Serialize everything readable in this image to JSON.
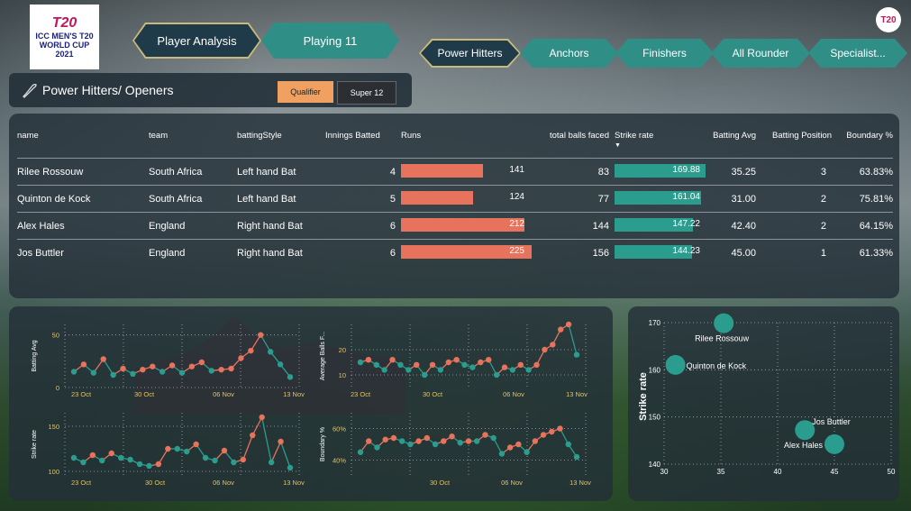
{
  "logo": {
    "brand": "T20",
    "line1": "ICC MEN'S T20",
    "line2": "WORLD CUP",
    "year": "2021",
    "small": "T20"
  },
  "nav_main": [
    {
      "label": "Player Analysis"
    },
    {
      "label": "Playing 11"
    }
  ],
  "nav_tabs": [
    {
      "label": "Power Hitters"
    },
    {
      "label": "Anchors"
    },
    {
      "label": "Finishers"
    },
    {
      "label": "All Rounder"
    },
    {
      "label": "Specialist..."
    }
  ],
  "section": {
    "title": "Power Hitters/ Openers",
    "filters": [
      {
        "label": "Qualifier"
      },
      {
        "label": "Super 12"
      }
    ]
  },
  "table": {
    "columns": {
      "name": "name",
      "team": "team",
      "style": "battingStyle",
      "innings": "Innings Batted",
      "runs": "Runs",
      "balls": "total balls faced",
      "sr": "Strike rate",
      "avg": "Batting Avg",
      "pos": "Batting Position",
      "bnd": "Boundary %"
    },
    "rows": [
      {
        "name": "Rilee Rossouw",
        "team": "South Africa",
        "style": "Left hand Bat",
        "innings": "4",
        "runs": "141",
        "runs_v": 141,
        "balls": "83",
        "sr": "169.88",
        "sr_v": 169.88,
        "avg": "35.25",
        "pos": "3",
        "bnd": "63.83%"
      },
      {
        "name": "Quinton de Kock",
        "team": "South Africa",
        "style": "Left hand Bat",
        "innings": "5",
        "runs": "124",
        "runs_v": 124,
        "balls": "77",
        "sr": "161.04",
        "sr_v": 161.04,
        "avg": "31.00",
        "pos": "2",
        "bnd": "75.81%"
      },
      {
        "name": "Alex Hales",
        "team": "England",
        "style": "Right hand Bat",
        "innings": "6",
        "runs": "212",
        "runs_v": 212,
        "balls": "144",
        "sr": "147.22",
        "sr_v": 147.22,
        "avg": "42.40",
        "pos": "2",
        "bnd": "64.15%"
      },
      {
        "name": "Jos Buttler",
        "team": "England",
        "style": "Right hand Bat",
        "innings": "6",
        "runs": "225",
        "runs_v": 225,
        "balls": "156",
        "sr": "144.23",
        "sr_v": 144.23,
        "avg": "45.00",
        "pos": "1",
        "bnd": "61.33%"
      }
    ]
  },
  "colors": {
    "runs_bar": "#e8735c",
    "sr_bar": "#2a9d8f",
    "teal_line": "#2a9d8f",
    "orange_line": "#e8735c",
    "axis_text": "#e0c36a"
  },
  "chart_data": [
    {
      "type": "line",
      "ylabel": "Batting Avg",
      "yticks": [
        "50",
        "0"
      ],
      "ylim": [
        0,
        60
      ],
      "xticks": [
        "23 Oct",
        "30 Oct",
        "06 Nov",
        "13 Nov"
      ],
      "series": [
        {
          "values": [
            15,
            22,
            14,
            27,
            12,
            18,
            13,
            17,
            20,
            15,
            21,
            14,
            20,
            24,
            16,
            17,
            18,
            28,
            35,
            50,
            34,
            22,
            10
          ]
        }
      ]
    },
    {
      "type": "line",
      "ylabel": "Average Balls F...",
      "yticks": [
        "20",
        "10"
      ],
      "ylim": [
        5,
        30
      ],
      "xticks": [
        "23 Oct",
        "30 Oct",
        "06 Nov",
        "13 Nov"
      ],
      "series": [
        {
          "values": [
            15,
            16,
            14,
            12,
            16,
            14,
            12,
            14,
            10,
            14,
            12,
            15,
            16,
            14,
            13,
            15,
            16,
            10,
            13,
            12,
            14,
            12,
            14,
            20,
            22,
            28,
            30,
            18
          ]
        }
      ]
    },
    {
      "type": "line",
      "ylabel": "Strike rate",
      "yticks": [
        "150",
        "100"
      ],
      "ylim": [
        95,
        165
      ],
      "xticks": [
        "23 Oct",
        "30 Oct",
        "06 Nov",
        "13 Nov"
      ],
      "series": [
        {
          "values": [
            115,
            110,
            118,
            112,
            120,
            115,
            113,
            108,
            106,
            108,
            125,
            125,
            122,
            130,
            115,
            112,
            123,
            110,
            113,
            140,
            160,
            110,
            133,
            104
          ]
        }
      ]
    },
    {
      "type": "line",
      "ylabel": "Boundary %",
      "yticks": [
        "60%",
        "40%"
      ],
      "ylim": [
        30,
        70
      ],
      "xticks": [
        "30 Oct",
        "06 Nov",
        "13 Nov"
      ],
      "series": [
        {
          "values": [
            45,
            52,
            48,
            53,
            54,
            52,
            50,
            52,
            54,
            50,
            52,
            55,
            51,
            52,
            52,
            56,
            54,
            44,
            48,
            50,
            45,
            52,
            56,
            58,
            60,
            50,
            42
          ]
        }
      ]
    },
    {
      "type": "scatter",
      "ylabel": "Strike rate",
      "xlim": [
        30,
        50
      ],
      "ylim": [
        140,
        170
      ],
      "xticks": [
        "30",
        "35",
        "40",
        "45",
        "50"
      ],
      "yticks": [
        "170",
        "160",
        "150",
        "140"
      ],
      "points": [
        {
          "label": "Rilee Rossouw",
          "x": 35.25,
          "y": 169.88
        },
        {
          "label": "Quinton de Kock",
          "x": 31.0,
          "y": 161.04
        },
        {
          "label": "Jos Buttler",
          "x": 42.4,
          "y": 147.22
        },
        {
          "label": "Alex Hales",
          "x": 45.0,
          "y": 144.23
        }
      ]
    }
  ]
}
